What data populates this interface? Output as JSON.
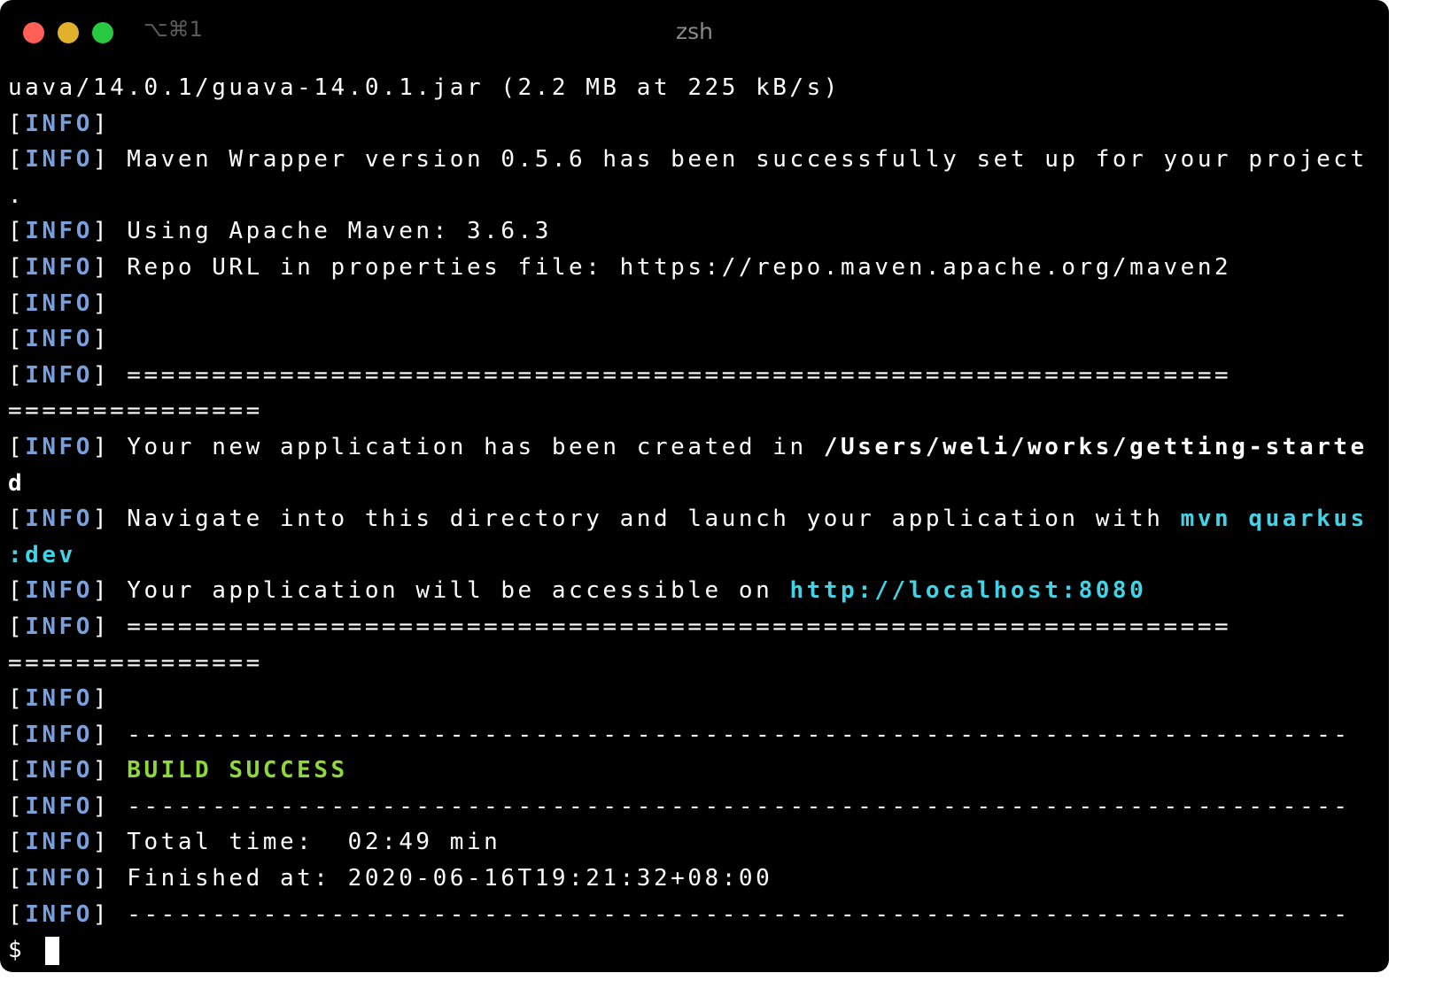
{
  "window": {
    "shortcut": "⌥⌘1",
    "title": "zsh"
  },
  "terminal": {
    "info_tag": "INFO",
    "lines": {
      "l0": "uava/14.0.1/guava-14.0.1.jar (2.2 MB at 225 kB/s)",
      "l2": " Maven Wrapper version 0.5.6 has been successfully set up for your project",
      "l3": ".",
      "l4": " Using Apache Maven: 3.6.3",
      "l5": " Repo URL in properties file: https://repo.maven.apache.org/maven2",
      "l8": " =================================================================",
      "l9": "===============",
      "l10a": " Your new application has been created in ",
      "l10b": "/Users/weli/works/getting-starte",
      "l11": "d",
      "l12a": " Navigate into this directory and launch your application with ",
      "l12b": "mvn quarkus",
      "l13": ":dev",
      "l14a": " Your application will be accessible on ",
      "l14b": "http://localhost:8080",
      "l15": " =================================================================",
      "l16": "===============",
      "l18": " ------------------------------------------------------------------------",
      "l19": "BUILD SUCCESS",
      "l20": " ------------------------------------------------------------------------",
      "l21": " Total time:  02:49 min",
      "l22": " Finished at: 2020-06-16T19:21:32+08:00",
      "l23": " ------------------------------------------------------------------------",
      "prompt": "$ "
    }
  },
  "colors": {
    "background": "#000000",
    "text": "#ffffff",
    "info": "#7aa0dc",
    "highlight": "#42d4e6",
    "success": "#8fd83a",
    "close": "#ff5f57",
    "minimize": "#e1b12c",
    "zoom": "#28c840"
  }
}
